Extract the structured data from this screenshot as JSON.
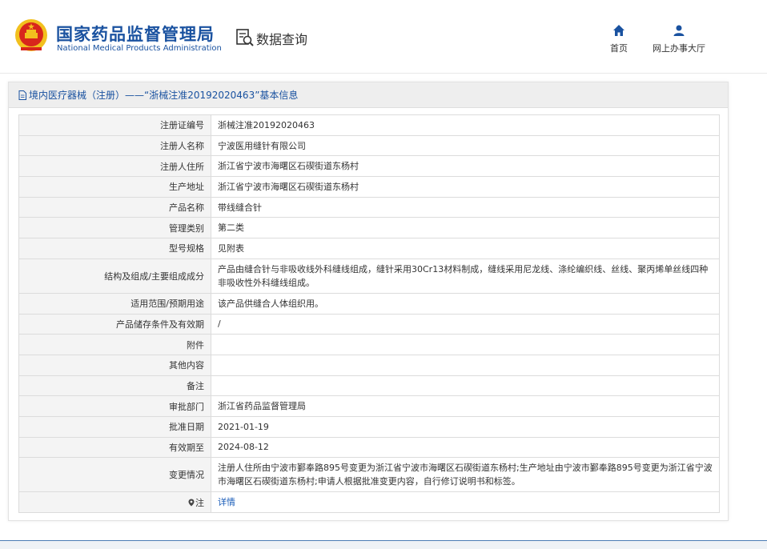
{
  "header": {
    "brand_cn": "国家药品监督管理局",
    "brand_en": "National Medical Products Administration",
    "query_title": "数据查询",
    "nav": {
      "home": "首页",
      "office": "网上办事大厅"
    }
  },
  "panel": {
    "title": "境内医疗器械（注册）——“浙械注准20192020463”基本信息"
  },
  "rows": [
    {
      "label": "注册证编号",
      "value": "浙械注准20192020463"
    },
    {
      "label": "注册人名称",
      "value": "宁波医用缝针有限公司"
    },
    {
      "label": "注册人住所",
      "value": "浙江省宁波市海曙区石碶街道东杨村"
    },
    {
      "label": "生产地址",
      "value": "浙江省宁波市海曙区石碶街道东杨村"
    },
    {
      "label": "产品名称",
      "value": "带线缝合针"
    },
    {
      "label": "管理类别",
      "value": "第二类"
    },
    {
      "label": "型号规格",
      "value": "见附表"
    },
    {
      "label": "结构及组成/主要组成成分",
      "value": "产品由缝合针与非吸收线外科缝线组成，缝针采用30Cr13材料制成，缝线采用尼龙线、涤纶编织线、丝线、聚丙烯单丝线四种非吸收性外科缝线组成。"
    },
    {
      "label": "适用范围/预期用途",
      "value": "该产品供缝合人体组织用。"
    },
    {
      "label": "产品储存条件及有效期",
      "value": "/"
    },
    {
      "label": "附件",
      "value": ""
    },
    {
      "label": "其他内容",
      "value": ""
    },
    {
      "label": "备注",
      "value": ""
    },
    {
      "label": "审批部门",
      "value": "浙江省药品监督管理局"
    },
    {
      "label": "批准日期",
      "value": "2021-01-19"
    },
    {
      "label": "有效期至",
      "value": "2024-08-12"
    },
    {
      "label": "变更情况",
      "value": "注册人住所由宁波市鄞奉路895号变更为浙江省宁波市海曙区石碶街道东杨村;生产地址由宁波市鄞奉路895号变更为浙江省宁波市海曙区石碶街道东杨村;申请人根据批准变更内容，自行修订说明书和标签。"
    }
  ],
  "note_row": {
    "label": "注",
    "link": "详情"
  },
  "colors": {
    "brand_blue": "#1a52a0",
    "link_blue": "#1a5cb8",
    "emblem_red": "#d8261c",
    "emblem_gold": "#f2c01e"
  },
  "icons": {
    "logo": "national-emblem-icon",
    "query": "search-document-icon",
    "home": "home-icon",
    "office": "user-icon",
    "title": "document-icon",
    "note": "pin-icon"
  }
}
